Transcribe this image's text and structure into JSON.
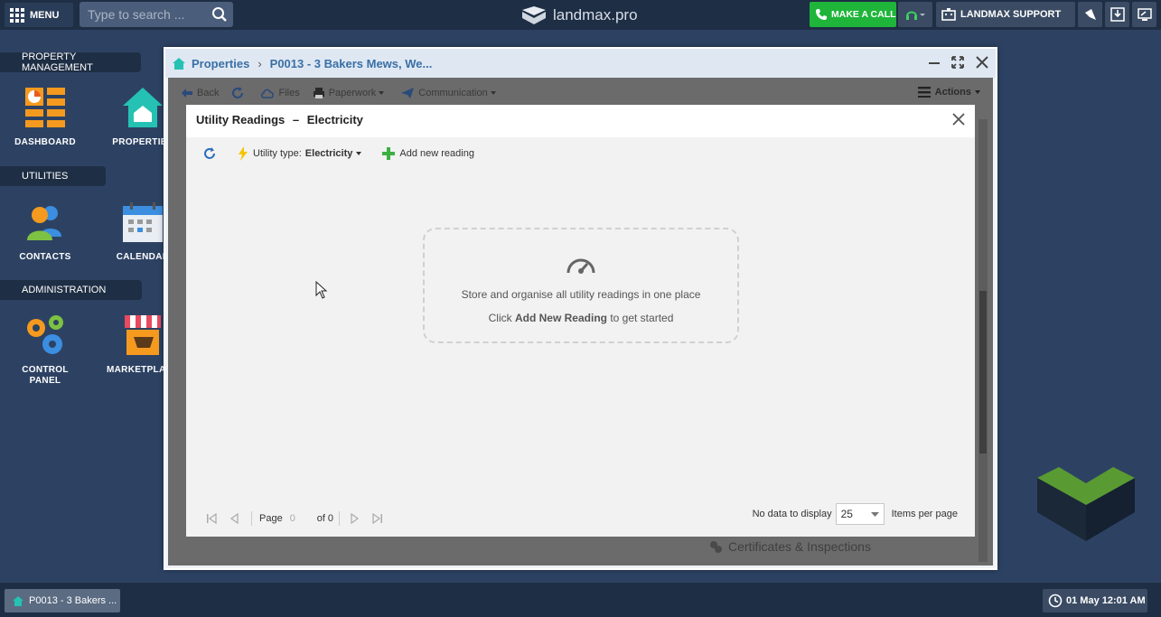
{
  "topbar": {
    "menu_label": "MENU",
    "search_placeholder": "Type to search ...",
    "brand": "landmax.pro",
    "call_label": "MAKE A CALL",
    "support_label": "LANDMAX SUPPORT"
  },
  "sidebar": {
    "sections": [
      {
        "label": "PROPERTY MANAGEMENT"
      },
      {
        "label": "UTILITIES"
      },
      {
        "label": "ADMINISTRATION"
      }
    ],
    "icons": {
      "dashboard": "DASHBOARD",
      "properties": "PROPERTIES",
      "contacts": "CONTACTS",
      "calendar": "CALENDAR",
      "control_panel_1": "CONTROL",
      "control_panel_2": "PANEL",
      "marketplace": "MARKETPLACE"
    }
  },
  "window": {
    "breadcrumb_root": "Properties",
    "breadcrumb_sep": "›",
    "breadcrumb_item": "P0013 - 3 Bakers Mews, We...",
    "toolbar": {
      "back": "Back",
      "files": "Files",
      "paperwork": "Paperwork",
      "communication": "Communication",
      "actions": "Actions"
    },
    "background_item": "Certificates & Inspections"
  },
  "dialog": {
    "title_prefix": "Utility Readings",
    "title_dash": "–",
    "title_type": "Electricity",
    "utility_type_label": "Utility type:",
    "utility_type_value": "Electricity",
    "add_new_label": "Add new reading",
    "empty_line1": "Store and organise all utility readings in one place",
    "empty_line2_prefix": "Click",
    "empty_line2_bold": "Add New Reading",
    "empty_line2_suffix": "to get started",
    "pager": {
      "page_label": "Page",
      "page_value": "0",
      "of_label": "of 0",
      "no_data": "No data to display",
      "per_page_value": "25",
      "per_page_label": "Items per page"
    }
  },
  "taskbar": {
    "task_label": "P0013 - 3 Bakers ...",
    "clock": "01 May 12:01 AM"
  },
  "colors": {
    "desktop_bg": "#2d4263",
    "topbar_bg": "#1e2e44",
    "call_green": "#1fb53a",
    "link_blue": "#3a6fa6"
  }
}
